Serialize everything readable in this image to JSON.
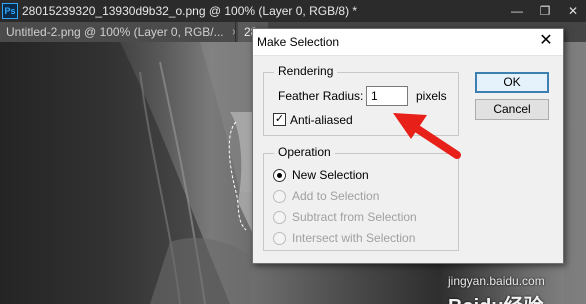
{
  "ps": {
    "logo": "Ps",
    "window_title": "28015239320_13930d9b32_o.png @ 100% (Layer 0, RGB/8) *",
    "controls": {
      "minimize": "—",
      "restore": "❐",
      "close": "✕"
    }
  },
  "tabs": [
    {
      "label": "Untitled-2.png @ 100% (Layer 0, RGB/...",
      "close": "×"
    },
    {
      "label": "28"
    }
  ],
  "dialog": {
    "title": "Make Selection",
    "close": "✕",
    "rendering": {
      "legend": "Rendering",
      "feather_label": "Feather Radius:",
      "feather_value": "1",
      "feather_unit": "pixels",
      "anti_aliased_label": "Anti-aliased",
      "anti_aliased_checked": true
    },
    "operation": {
      "legend": "Operation",
      "options": [
        {
          "label": "New Selection",
          "selected": true,
          "enabled": true
        },
        {
          "label": "Add to Selection",
          "selected": false,
          "enabled": false
        },
        {
          "label": "Subtract from Selection",
          "selected": false,
          "enabled": false
        },
        {
          "label": "Intersect with Selection",
          "selected": false,
          "enabled": false
        }
      ]
    },
    "buttons": {
      "ok": "OK",
      "cancel": "Cancel"
    }
  },
  "watermark": {
    "brand": "Baidu经验",
    "url": "jingyan.baidu.com"
  },
  "colors": {
    "arrow": "#e8201a",
    "ok_border": "#3c7fb1",
    "ps_accent": "#31a8ff"
  }
}
